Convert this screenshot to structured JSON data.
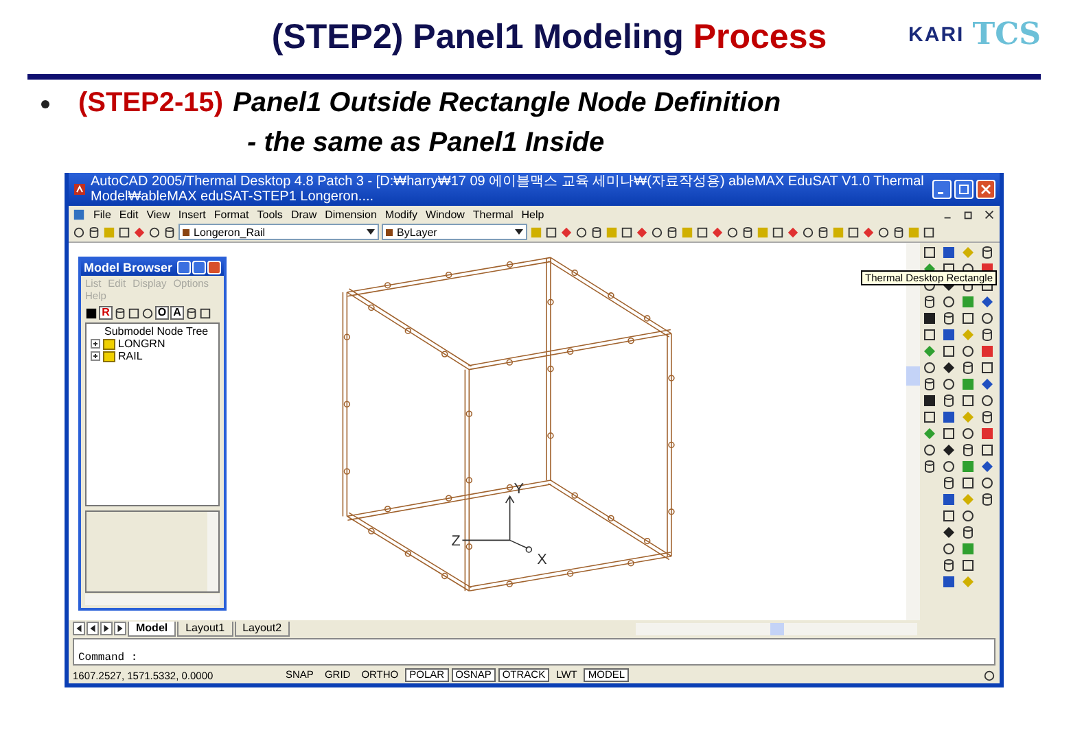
{
  "slide": {
    "title": "(STEP2) Panel1 Modeling",
    "title_highlight": "Process",
    "logos": [
      {
        "text": "KARI"
      },
      {
        "text": "TCS"
      }
    ]
  },
  "bullet": {
    "step": "(STEP2-15)",
    "heading": "Panel1 Outside Rectangle Node Definition",
    "subline": "- the same as Panel1 Inside"
  },
  "window": {
    "title": "AutoCAD 2005/Thermal Desktop 4.8 Patch 3 - [D:₩harry₩17 09 에이블맥스 교육 세미나₩(자료작성용) ableMAX EduSAT V1.0 Thermal Model₩ableMAX eduSAT-STEP1 Longeron....",
    "menu": [
      "File",
      "Edit",
      "View",
      "Insert",
      "Format",
      "Tools",
      "Draw",
      "Dimension",
      "Modify",
      "Window",
      "Thermal",
      "Help"
    ],
    "layer": "Longeron_Rail",
    "color_dropdown": "ByLayer"
  },
  "model_browser": {
    "title": "Model Browser",
    "menu": [
      {
        "label": "List",
        "disabled": true
      },
      {
        "label": "Edit",
        "disabled": true
      },
      {
        "label": "Display",
        "disabled": true
      },
      {
        "label": "Options",
        "disabled": true
      },
      {
        "label": "Help",
        "disabled": true
      }
    ],
    "toolbar_letters": [
      "R",
      "O",
      "A"
    ],
    "tree": {
      "label": "Submodel Node Tree",
      "children": [
        {
          "label": "LONGRN",
          "expanded": false
        },
        {
          "label": "RAIL",
          "expanded": false
        }
      ]
    }
  },
  "viewport": {
    "axis_labels": [
      "Y",
      "Z",
      "X"
    ],
    "tooltip": "Thermal Desktop Rectangle"
  },
  "layout_tabs": [
    {
      "label": "Model",
      "selected": true
    },
    {
      "label": "Layout1",
      "selected": false
    },
    {
      "label": "Layout2",
      "selected": false
    }
  ],
  "command": {
    "prompt": "Command :"
  },
  "status_bar": {
    "coordinates": "1607.2527, 1571.5332, 0.0000",
    "toggles": [
      {
        "label": "SNAP",
        "on": false
      },
      {
        "label": "GRID",
        "on": false
      },
      {
        "label": "ORTHO",
        "on": false
      },
      {
        "label": "POLAR",
        "on": true
      },
      {
        "label": "OSNAP",
        "on": true
      },
      {
        "label": "OTRACK",
        "on": true
      },
      {
        "label": "LWT",
        "on": false
      },
      {
        "label": "MODEL",
        "on": true
      }
    ]
  }
}
